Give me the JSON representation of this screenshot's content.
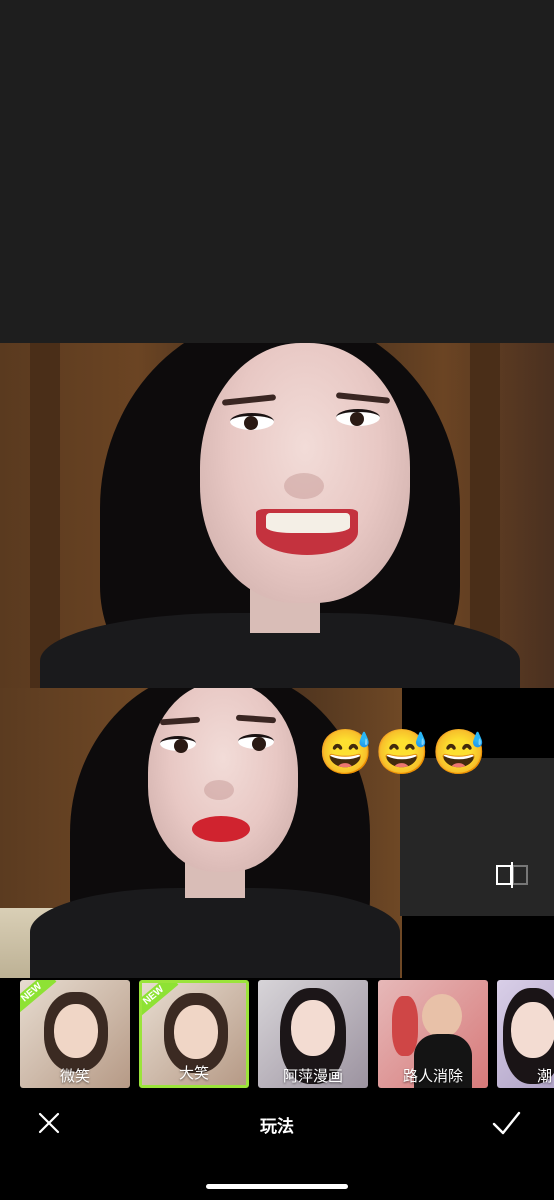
{
  "emojis": "😅😅😅",
  "effects": [
    {
      "label": "微笑",
      "badge": "NEW",
      "selected": false
    },
    {
      "label": "大笑",
      "badge": "NEW",
      "selected": true
    },
    {
      "label": "阿萍漫画",
      "badge": "",
      "selected": false
    },
    {
      "label": "路人消除",
      "badge": "",
      "selected": false
    },
    {
      "label": "潮",
      "badge": "",
      "selected": false
    }
  ],
  "toolbar": {
    "title": "玩法"
  },
  "colors": {
    "accent": "#9be43b",
    "background": "#000000",
    "panel": "#262626"
  },
  "icons": {
    "close": "close-icon",
    "confirm": "check-icon",
    "compare": "compare-icon"
  }
}
